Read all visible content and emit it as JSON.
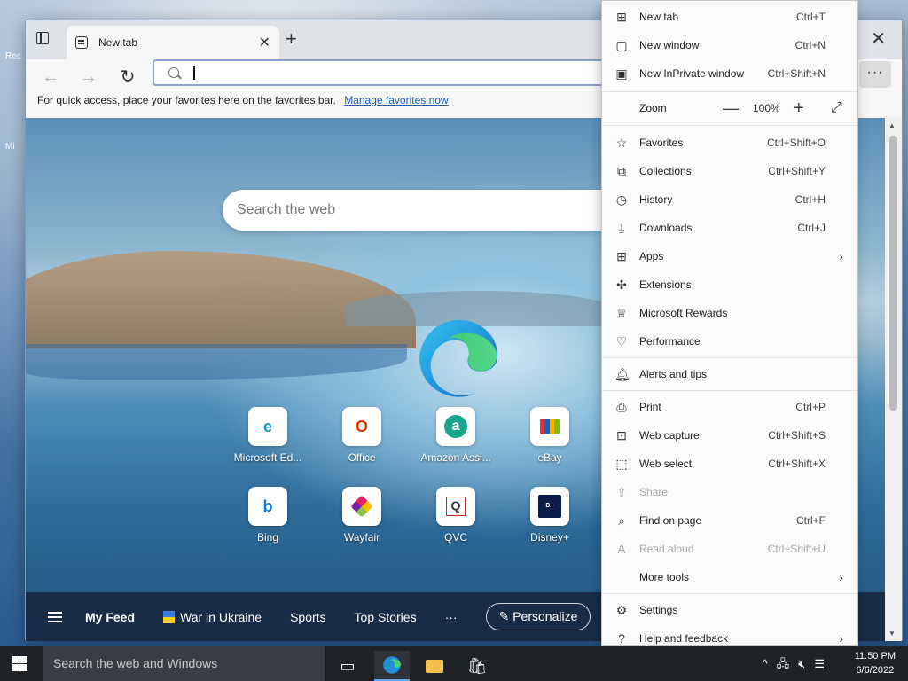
{
  "desktop": {
    "icon1_label": "Rec",
    "icon2_label": "Mi"
  },
  "browser": {
    "tab_title": "New tab",
    "address_value": "",
    "favorites_bar_text": "For quick access, place your favorites here on the favorites bar.",
    "favorites_bar_link": "Manage favorites now",
    "search_placeholder": "Search the web",
    "tiles": [
      {
        "label": "Microsoft Ed...",
        "icon": "edge-icon"
      },
      {
        "label": "Office",
        "icon": "office-icon"
      },
      {
        "label": "Amazon Assi...",
        "icon": "amazon-icon"
      },
      {
        "label": "eBay",
        "icon": "ebay-icon"
      },
      {
        "label": "Bing",
        "icon": "bing-icon"
      },
      {
        "label": "Wayfair",
        "icon": "wayfair-icon"
      },
      {
        "label": "QVC",
        "icon": "qvc-icon"
      },
      {
        "label": "Disney+",
        "icon": "disney-icon"
      }
    ],
    "feed": {
      "my_feed": "My Feed",
      "war": "War in Ukraine",
      "sports": "Sports",
      "top_stories": "Top Stories",
      "more": "···",
      "personalize": "Personalize"
    }
  },
  "menu": {
    "items": [
      {
        "label": "New tab",
        "shortcut": "Ctrl+T"
      },
      {
        "label": "New window",
        "shortcut": "Ctrl+N"
      },
      {
        "label": "New InPrivate window",
        "shortcut": "Ctrl+Shift+N"
      },
      {
        "label": "Favorites",
        "shortcut": "Ctrl+Shift+O"
      },
      {
        "label": "Collections",
        "shortcut": "Ctrl+Shift+Y"
      },
      {
        "label": "History",
        "shortcut": "Ctrl+H"
      },
      {
        "label": "Downloads",
        "shortcut": "Ctrl+J"
      },
      {
        "label": "Apps",
        "shortcut": ""
      },
      {
        "label": "Extensions",
        "shortcut": ""
      },
      {
        "label": "Microsoft Rewards",
        "shortcut": ""
      },
      {
        "label": "Performance",
        "shortcut": ""
      },
      {
        "label": "Alerts and tips",
        "shortcut": ""
      },
      {
        "label": "Print",
        "shortcut": "Ctrl+P"
      },
      {
        "label": "Web capture",
        "shortcut": "Ctrl+Shift+S"
      },
      {
        "label": "Web select",
        "shortcut": "Ctrl+Shift+X"
      },
      {
        "label": "Share",
        "shortcut": ""
      },
      {
        "label": "Find on page",
        "shortcut": "Ctrl+F"
      },
      {
        "label": "Read aloud",
        "shortcut": "Ctrl+Shift+U"
      },
      {
        "label": "More tools",
        "shortcut": ""
      },
      {
        "label": "Settings",
        "shortcut": ""
      },
      {
        "label": "Help and feedback",
        "shortcut": ""
      }
    ],
    "zoom_label": "Zoom",
    "zoom_value": "100%"
  },
  "taskbar": {
    "search_placeholder": "Search the web and Windows",
    "time": "11:50 PM",
    "date": "6/6/2022"
  }
}
